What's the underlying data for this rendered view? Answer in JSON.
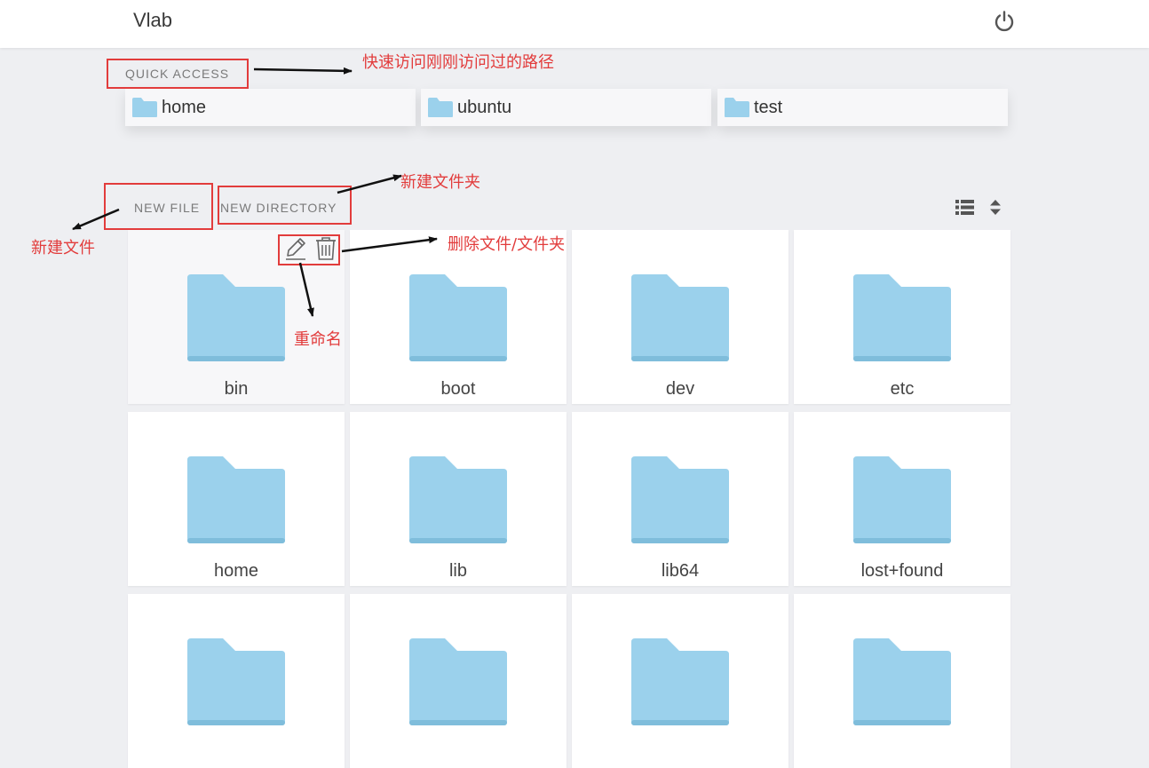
{
  "header": {
    "title": "Vlab",
    "power_icon": "power-icon"
  },
  "quick_access": {
    "label": "QUICK ACCESS",
    "items": [
      {
        "name": "home"
      },
      {
        "name": "ubuntu"
      },
      {
        "name": "test"
      }
    ]
  },
  "toolbar": {
    "new_file": "NEW FILE",
    "new_directory": "NEW DIRECTORY",
    "view_icon": "list-view-icon",
    "sort_icon": "sort-icon"
  },
  "files": [
    {
      "name": "bin"
    },
    {
      "name": "boot"
    },
    {
      "name": "dev"
    },
    {
      "name": "etc"
    },
    {
      "name": "home"
    },
    {
      "name": "lib"
    },
    {
      "name": "lib64"
    },
    {
      "name": "lost+found"
    },
    {
      "name": ""
    },
    {
      "name": ""
    },
    {
      "name": ""
    },
    {
      "name": ""
    }
  ],
  "annotations": {
    "quick_access": "快速访问刚刚访问过的路径",
    "new_directory": "新建文件夹",
    "new_file": "新建文件",
    "delete": "删除文件/文件夹",
    "rename": "重命名"
  },
  "colors": {
    "folder": "#9bd1ec",
    "folder_shadow": "#7fbddb",
    "annotation": "#e23c3c"
  }
}
